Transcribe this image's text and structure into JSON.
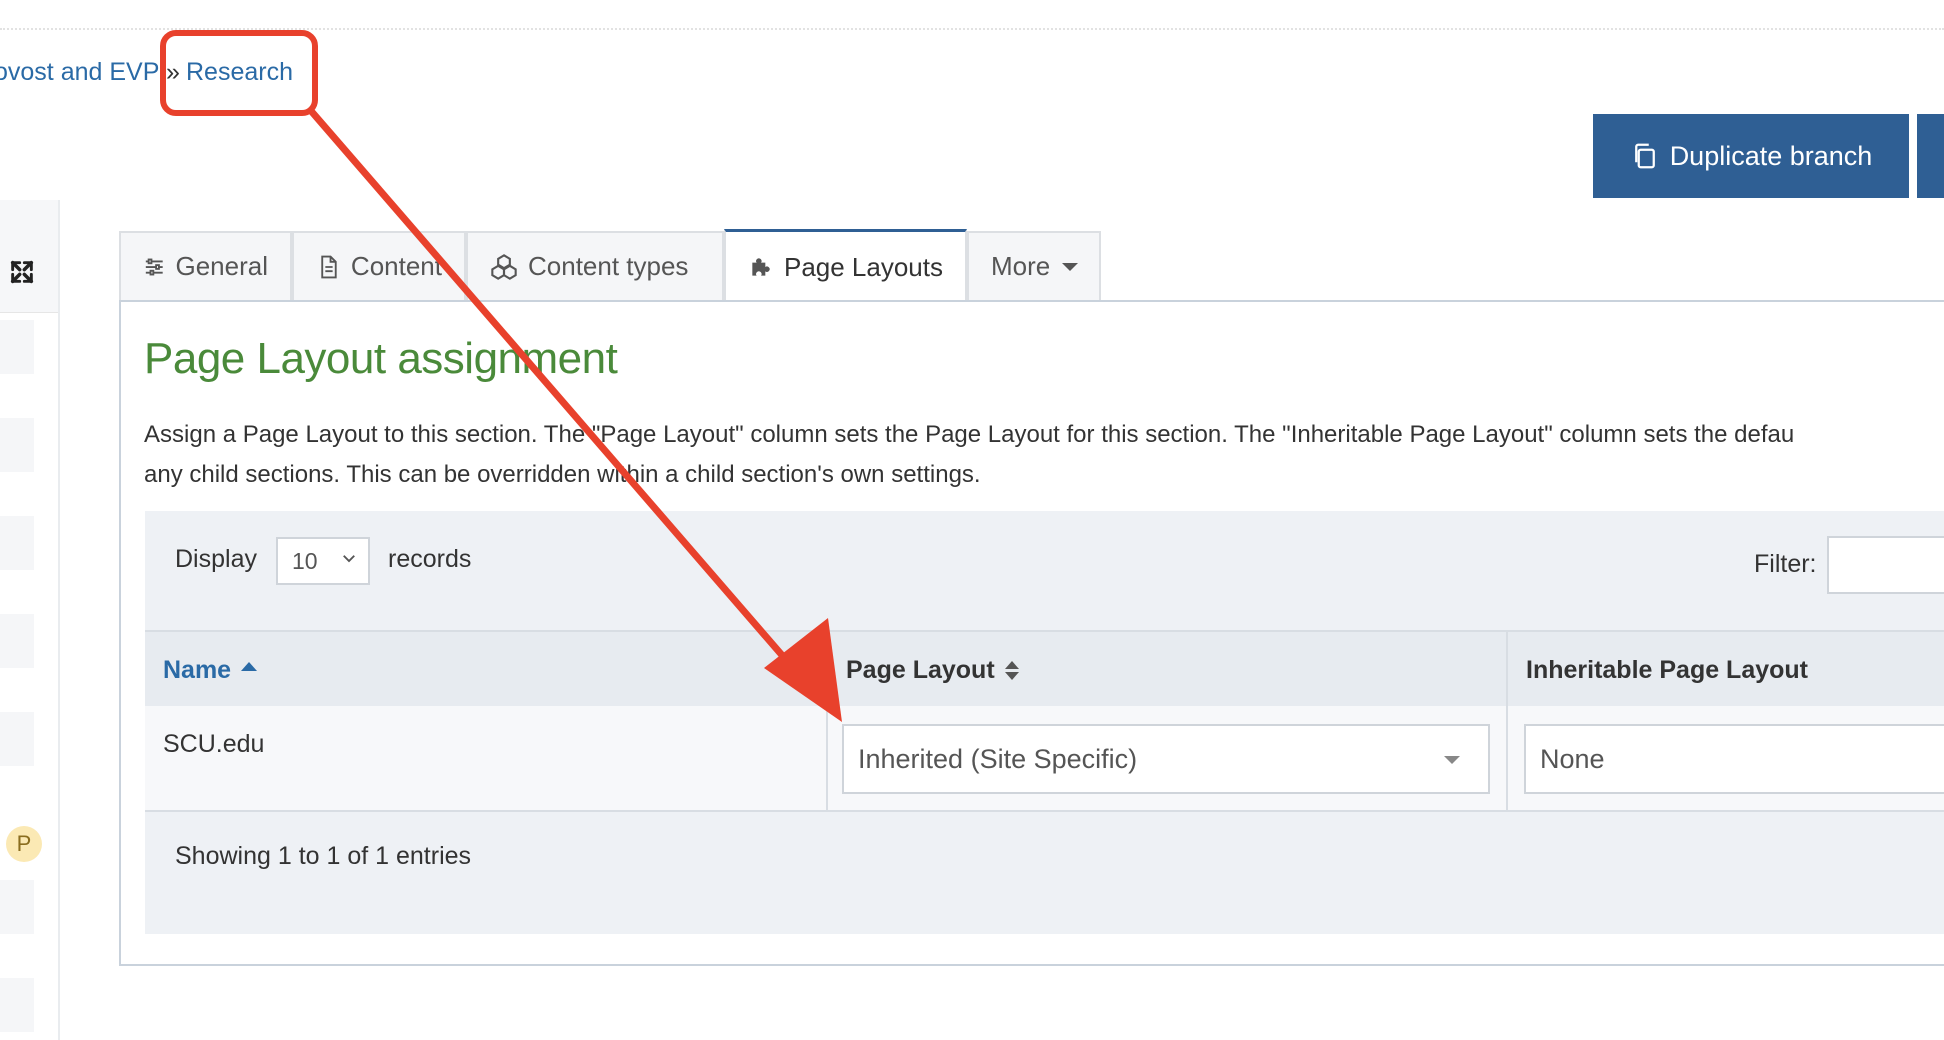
{
  "breadcrumb": {
    "parent_partial": "ovost and EVP",
    "separator": "»",
    "current": "Research"
  },
  "actions": {
    "duplicate_branch": "Duplicate branch"
  },
  "tabs": [
    {
      "label": "General",
      "icon": "sliders-icon"
    },
    {
      "label": "Content",
      "icon": "document-icon"
    },
    {
      "label": "Content types",
      "icon": "cubes-icon"
    },
    {
      "label": "Page Layouts",
      "icon": "puzzle-icon",
      "active": true
    },
    {
      "label": "More",
      "icon": "caret-down-icon"
    }
  ],
  "panel": {
    "title": "Page Layout assignment",
    "description_line1": "Assign a Page Layout to this section. The \"Page Layout\" column sets the Page Layout for this section. The \"Inheritable Page Layout\" column sets the defau",
    "description_line2": "any child sections. This can be overridden within a child section's own settings."
  },
  "table_controls": {
    "display_label": "Display",
    "display_value": "10",
    "records_label": "records",
    "filter_label": "Filter:"
  },
  "table": {
    "columns": [
      "Name",
      "Page Layout",
      "Inheritable Page Layout"
    ],
    "rows": [
      {
        "name": "SCU.edu",
        "page_layout": "Inherited (Site Specific)",
        "inheritable_page_layout": "None"
      }
    ],
    "info": "Showing 1 to 1 of 1 entries"
  },
  "sidebar": {
    "badge": "P"
  },
  "colors": {
    "primary": "#2f5f94",
    "link": "#2a6aa6",
    "title_green": "#4a8a3a",
    "annotation_red": "#e8412c"
  }
}
